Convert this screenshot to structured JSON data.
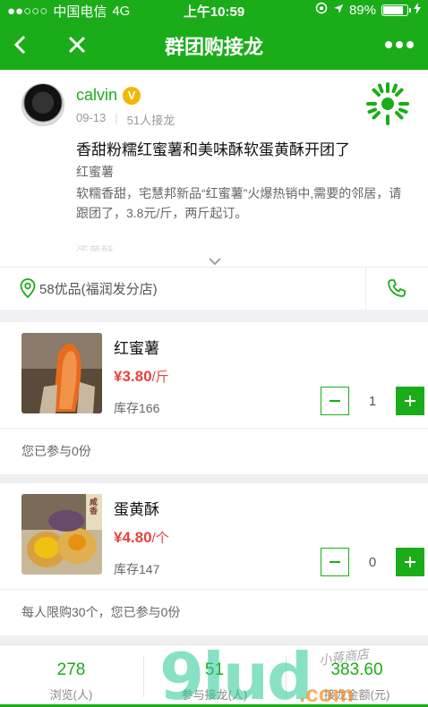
{
  "status_bar": {
    "signal": "●●○○○",
    "carrier": "中国电信",
    "network": "4G",
    "time": "上午10:59",
    "battery": "89%"
  },
  "nav": {
    "title": "群团购接龙"
  },
  "post": {
    "author": "calvin",
    "verified_badge": "V",
    "date": "09-13",
    "participants": "51人接龙",
    "title": "香甜粉糯红蜜薯和美味酥软蛋黄酥开团了",
    "subtitle": "红蜜薯",
    "body": "软糯香甜，宅慧邦新品“红蜜薯”火爆热销中,需要的邻居，请跟团了，3.8元/斤，两斤起订。",
    "faded_text": "蛋黄酥",
    "store": "58优品(福润发分店)"
  },
  "products": [
    {
      "name": "红蜜薯",
      "price": "¥3.80",
      "unit": "/斤",
      "stock": "库存166",
      "qty": "1",
      "footer": "您已参与0份"
    },
    {
      "name": "蛋黄酥",
      "price": "¥4.80",
      "unit": "/个",
      "stock": "库存147",
      "qty": "0",
      "footer": "每人限购30个，您已参与0份",
      "package_label": "咸香"
    }
  ],
  "stats": [
    {
      "value": "278",
      "label": "浏览(人)"
    },
    {
      "value": "51",
      "label": "参与接龙(人)"
    },
    {
      "value": "383.60",
      "label": "接龙金额(元)"
    }
  ],
  "watermark": {
    "logo": "9lud",
    "domain": ".com",
    "handwriting": "小蒋商店"
  },
  "colors": {
    "brand_green": "#1aad19",
    "price_red": "#e64340"
  }
}
